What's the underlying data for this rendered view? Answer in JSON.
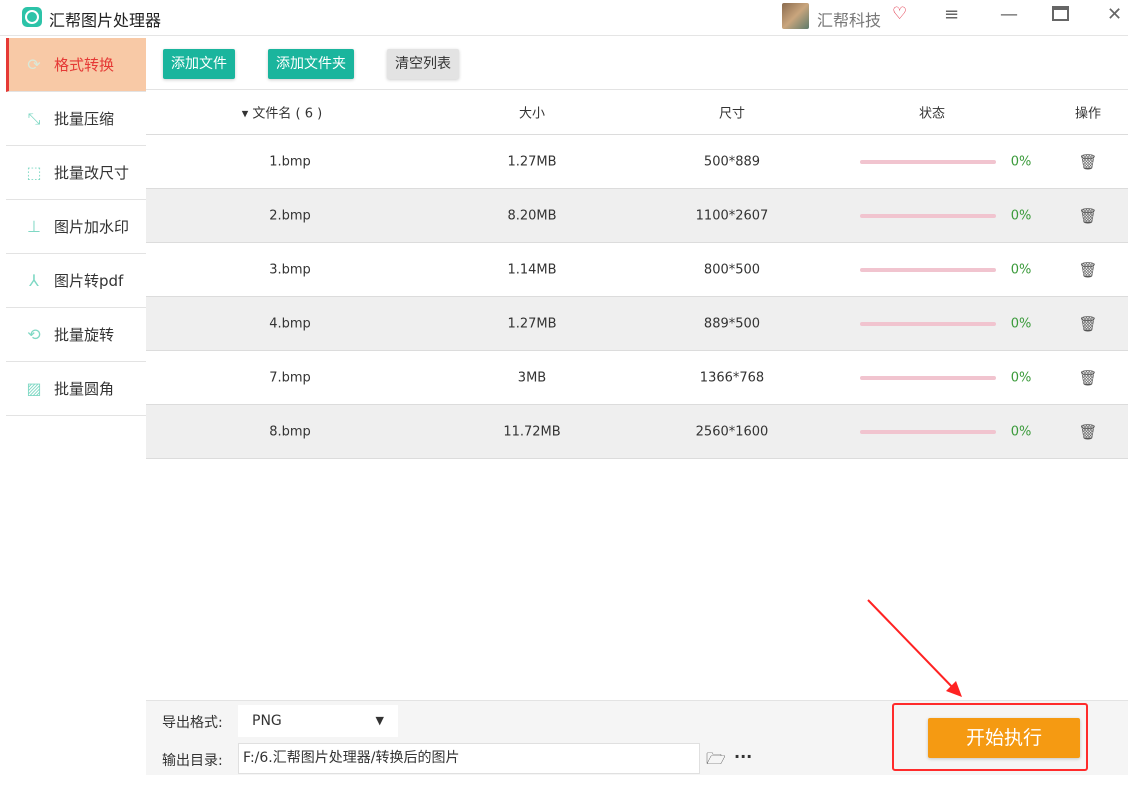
{
  "app": {
    "title": "汇帮图片处理器",
    "user": "汇帮科技"
  },
  "sidebar": {
    "items": [
      {
        "label": "格式转换",
        "icon": "convert-icon"
      },
      {
        "label": "批量压缩",
        "icon": "compress-icon"
      },
      {
        "label": "批量改尺寸",
        "icon": "resize-icon"
      },
      {
        "label": "图片加水印",
        "icon": "watermark-icon"
      },
      {
        "label": "图片转pdf",
        "icon": "pdf-icon"
      },
      {
        "label": "批量旋转",
        "icon": "rotate-icon"
      },
      {
        "label": "批量圆角",
        "icon": "image-corner-icon"
      }
    ]
  },
  "toolbar": {
    "add_file": "添加文件",
    "add_folder": "添加文件夹",
    "clear": "清空列表"
  },
  "table": {
    "headers": {
      "name": "▾ 文件名 ( 6 )",
      "size": "大小",
      "dim": "尺寸",
      "status": "状态",
      "action": "操作"
    },
    "rows": [
      {
        "name": "1.bmp",
        "size": "1.27MB",
        "dim": "500*889",
        "progress": "0%"
      },
      {
        "name": "2.bmp",
        "size": "8.20MB",
        "dim": "1100*2607",
        "progress": "0%"
      },
      {
        "name": "3.bmp",
        "size": "1.14MB",
        "dim": "800*500",
        "progress": "0%"
      },
      {
        "name": "4.bmp",
        "size": "1.27MB",
        "dim": "889*500",
        "progress": "0%"
      },
      {
        "name": "7.bmp",
        "size": "3MB",
        "dim": "1366*768",
        "progress": "0%"
      },
      {
        "name": "8.bmp",
        "size": "11.72MB",
        "dim": "2560*1600",
        "progress": "0%"
      }
    ]
  },
  "bottom": {
    "format_label": "导出格式:",
    "format_value": "PNG",
    "dir_label": "输出目录:",
    "dir_value": "F:/6.汇帮图片处理器/转换后的图片",
    "more": "···",
    "start": "开始执行"
  }
}
